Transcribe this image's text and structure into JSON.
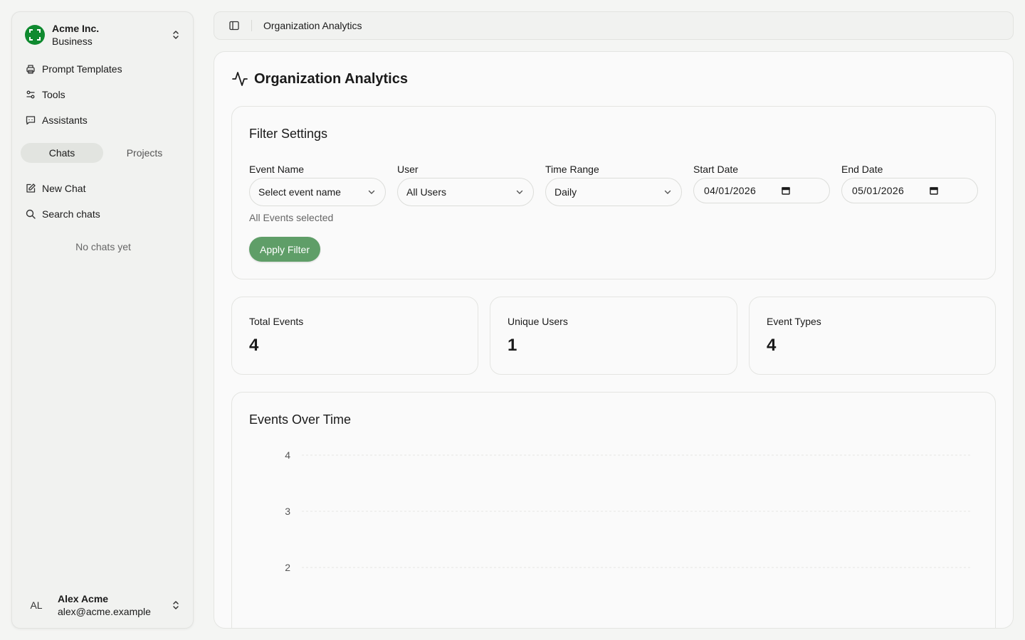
{
  "sidebar": {
    "org": {
      "name": "Acme Inc.",
      "plan": "Business"
    },
    "nav": [
      {
        "label": "Prompt Templates",
        "icon": "printer-icon"
      },
      {
        "label": "Tools",
        "icon": "sliders-icon"
      },
      {
        "label": "Assistants",
        "icon": "bot-message-icon"
      }
    ],
    "tabs": {
      "chats": "Chats",
      "projects": "Projects"
    },
    "actions": {
      "new_chat": "New Chat",
      "search_chats": "Search chats"
    },
    "empty_text": "No chats yet",
    "user": {
      "initials": "AL",
      "name": "Alex Acme",
      "email": "alex@acme.example"
    }
  },
  "header": {
    "breadcrumb": "Organization Analytics"
  },
  "main": {
    "title": "Organization Analytics",
    "filters": {
      "title": "Filter Settings",
      "event_name": {
        "label": "Event Name",
        "value": "Select event name"
      },
      "user": {
        "label": "User",
        "value": "All Users"
      },
      "time_range": {
        "label": "Time Range",
        "value": "Daily"
      },
      "start_date": {
        "label": "Start Date",
        "value": "04/01/2026"
      },
      "end_date": {
        "label": "End Date",
        "value": "05/01/2026"
      },
      "hint": "All Events selected",
      "apply_label": "Apply Filter"
    },
    "stats": [
      {
        "label": "Total Events",
        "value": "4"
      },
      {
        "label": "Unique Users",
        "value": "1"
      },
      {
        "label": "Event Types",
        "value": "4"
      }
    ],
    "chart_title": "Events Over Time"
  },
  "colors": {
    "accent": "#5f9e68",
    "logo": "#0f8a2f"
  },
  "chart_data": {
    "type": "line",
    "title": "Events Over Time",
    "y_ticks": [
      4,
      3,
      2
    ],
    "ylim": [
      2,
      4
    ],
    "grid": true,
    "series": []
  }
}
